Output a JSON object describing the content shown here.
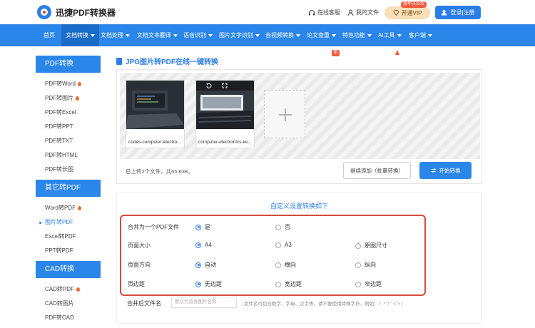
{
  "header": {
    "logo_text": "迅捷PDF转换器",
    "service_label": "在线客服",
    "myfiles_label": "我的文件",
    "vip_tag": "周年庆狂欢",
    "vip_label": "开通VIP",
    "login_label": "登录|注册"
  },
  "nav": {
    "items": [
      {
        "label": "首页",
        "dropdown": false
      },
      {
        "label": "文档转换",
        "dropdown": true
      },
      {
        "label": "文档处理",
        "dropdown": true
      },
      {
        "label": "文档文本翻译",
        "dropdown": true
      },
      {
        "label": "语音识别",
        "dropdown": true
      },
      {
        "label": "图片文字识别",
        "dropdown": true
      },
      {
        "label": "音视频转换",
        "dropdown": true
      },
      {
        "label": "论文查重",
        "dropdown": true
      },
      {
        "label": "特色功能",
        "dropdown": true
      },
      {
        "label": "AI工具",
        "dropdown": true
      },
      {
        "label": "客户端",
        "dropdown": true
      }
    ],
    "new_badge": "新"
  },
  "sidebar": {
    "sections": [
      {
        "title": "PDF转换",
        "items": [
          {
            "label": "PDF转Word",
            "hot": true
          },
          {
            "label": "PDF转图片",
            "hot": true
          },
          {
            "label": "PDF转Excel",
            "hot": false
          },
          {
            "label": "PDF转PPT",
            "hot": false
          },
          {
            "label": "PDF转TXT",
            "hot": false
          },
          {
            "label": "PDF转HTML",
            "hot": false
          },
          {
            "label": "PDF转长图",
            "hot": false
          }
        ]
      },
      {
        "title": "其它转PDF",
        "items": [
          {
            "label": "Word转PDF",
            "hot": true
          },
          {
            "label": "图片转PDF",
            "hot": false,
            "selected": true
          },
          {
            "label": "Excel转PDF",
            "hot": false
          },
          {
            "label": "PPT转PDF",
            "hot": false
          }
        ]
      },
      {
        "title": "CAD转换",
        "items": [
          {
            "label": "CAD转PDF",
            "hot": true
          },
          {
            "label": "CAD转图片",
            "hot": false
          },
          {
            "label": "PDF转CAD",
            "hot": false
          }
        ]
      }
    ]
  },
  "main": {
    "title": "JPG图片转PDF在线一键转换",
    "files": [
      {
        "name": "codes-computer-electro..."
      },
      {
        "name": "computer-electronics-ke..."
      }
    ],
    "upload_info": "已上传2个文件，共65.63K。",
    "continue_label": "继续添加（批量转换）",
    "start_label": "开始转换"
  },
  "settings": {
    "title": "自定义设置转换如下",
    "rows": [
      {
        "label": "合并为一个PDF文件",
        "options": [
          {
            "label": "是",
            "checked": true
          },
          {
            "label": "否",
            "checked": false
          }
        ]
      },
      {
        "label": "页面大小",
        "options": [
          {
            "label": "A4",
            "checked": true
          },
          {
            "label": "A3",
            "checked": false
          },
          {
            "label": "原图尺寸",
            "checked": false
          }
        ]
      },
      {
        "label": "页面方向",
        "options": [
          {
            "label": "自动",
            "checked": true
          },
          {
            "label": "横向",
            "checked": false
          },
          {
            "label": "纵向",
            "checked": false
          }
        ]
      },
      {
        "label": "页边距",
        "options": [
          {
            "label": "无边距",
            "checked": true
          },
          {
            "label": "宽边距",
            "checked": false
          },
          {
            "label": "窄边距",
            "checked": false
          }
        ]
      }
    ],
    "filename_label": "合并后文件名",
    "filename_placeholder": "默认为首张图片名称",
    "filename_hint": "文件名可包含数字、字母、汉字等，请不要使用特殊字符，例如：/ : * ? \" < > |"
  },
  "colors": {
    "primary": "#2b86ea",
    "nav_active": "#1a6cc8",
    "highlight_box": "#d84a3a",
    "hot": "#f26a2a"
  }
}
